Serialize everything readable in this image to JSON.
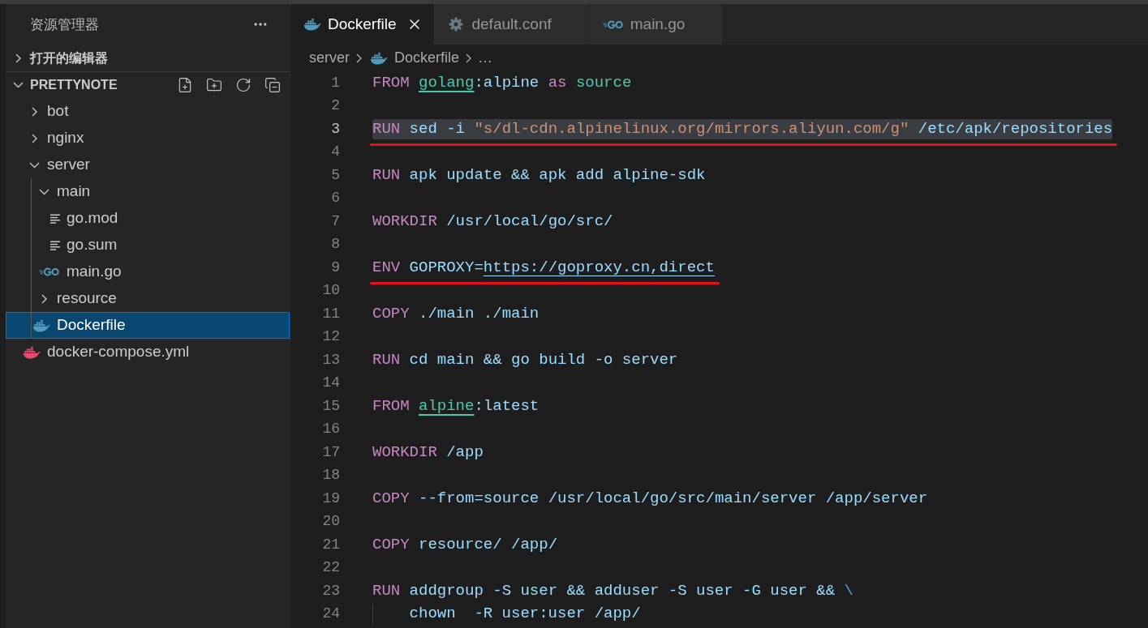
{
  "sidebar": {
    "title": "资源管理器",
    "sections": [
      {
        "label": "打开的编辑器",
        "expanded": false,
        "toolbar": false
      },
      {
        "label": "PRETTYNOTE",
        "expanded": true,
        "toolbar": true,
        "items": [
          {
            "label": "bot",
            "kind": "folder",
            "expanded": false,
            "selected": false
          },
          {
            "label": "nginx",
            "kind": "folder",
            "expanded": false,
            "selected": false
          },
          {
            "label": "server",
            "kind": "folder",
            "expanded": true,
            "selected": false,
            "children": [
              {
                "label": "main",
                "kind": "folder",
                "expanded": true,
                "selected": false,
                "children": [
                  {
                    "label": "go.mod",
                    "kind": "text-file",
                    "selected": false
                  },
                  {
                    "label": "go.sum",
                    "kind": "text-file",
                    "selected": false
                  },
                  {
                    "label": "main.go",
                    "kind": "go-file",
                    "selected": false
                  }
                ]
              },
              {
                "label": "resource",
                "kind": "folder",
                "expanded": false,
                "selected": false
              },
              {
                "label": "Dockerfile",
                "kind": "dockerfile",
                "selected": true
              }
            ]
          },
          {
            "label": "docker-compose.yml",
            "kind": "compose-file",
            "selected": false
          }
        ]
      }
    ]
  },
  "tabs": [
    {
      "label": "Dockerfile",
      "kind": "dockerfile",
      "selected": true
    },
    {
      "label": "default.conf",
      "kind": "config-file",
      "selected": false
    },
    {
      "label": "main.go",
      "kind": "go-file",
      "selected": false
    }
  ],
  "breadcrumbs": [
    {
      "label": "server",
      "kind": "folder"
    },
    {
      "label": "Dockerfile",
      "kind": "dockerfile"
    },
    {
      "label": "…",
      "kind": "more"
    }
  ],
  "editor": {
    "lines": [
      {
        "number": "1",
        "selected": false,
        "annotated": false,
        "tokens": [
          {
            "kind": "keyword",
            "text": "FROM "
          },
          {
            "kind": "image",
            "text": "golang"
          },
          {
            "kind": "text",
            "text": ":alpine "
          },
          {
            "kind": "keyword",
            "text": "as "
          },
          {
            "kind": "stage",
            "text": "source"
          }
        ]
      },
      {
        "number": "2",
        "selected": false,
        "annotated": false
      },
      {
        "number": "3",
        "selected": true,
        "annotated": true,
        "tokens": [
          {
            "kind": "keyword",
            "text": "RUN "
          },
          {
            "kind": "text",
            "text": "sed -i "
          },
          {
            "kind": "string",
            "text": "\"s/dl-cdn.alpinelinux.org/mirrors.aliyun.com/g\""
          },
          {
            "kind": "text",
            "text": " /etc/apk/repositories"
          }
        ]
      },
      {
        "number": "4",
        "selected": false,
        "annotated": false
      },
      {
        "number": "5",
        "selected": false,
        "annotated": false,
        "tokens": [
          {
            "kind": "keyword",
            "text": "RUN "
          },
          {
            "kind": "text",
            "text": "apk update && apk add alpine-sdk"
          }
        ]
      },
      {
        "number": "6",
        "selected": false,
        "annotated": false
      },
      {
        "number": "7",
        "selected": false,
        "annotated": false,
        "tokens": [
          {
            "kind": "keyword",
            "text": "WORKDIR "
          },
          {
            "kind": "text",
            "text": "/usr/local/go/src/"
          }
        ]
      },
      {
        "number": "8",
        "selected": false,
        "annotated": false
      },
      {
        "number": "9",
        "selected": false,
        "annotated": true,
        "tokens": [
          {
            "kind": "keyword",
            "text": "ENV "
          },
          {
            "kind": "text",
            "text": "GOPROXY="
          },
          {
            "kind": "url",
            "text": "https://goproxy.cn,direct"
          }
        ]
      },
      {
        "number": "10",
        "selected": false,
        "annotated": false
      },
      {
        "number": "11",
        "selected": false,
        "annotated": false,
        "tokens": [
          {
            "kind": "keyword",
            "text": "COPY "
          },
          {
            "kind": "text",
            "text": "./main ./main"
          }
        ]
      },
      {
        "number": "12",
        "selected": false,
        "annotated": false
      },
      {
        "number": "13",
        "selected": false,
        "annotated": false,
        "tokens": [
          {
            "kind": "keyword",
            "text": "RUN "
          },
          {
            "kind": "text",
            "text": "cd main && go build -o server"
          }
        ]
      },
      {
        "number": "14",
        "selected": false,
        "annotated": false
      },
      {
        "number": "15",
        "selected": false,
        "annotated": false,
        "tokens": [
          {
            "kind": "keyword",
            "text": "FROM "
          },
          {
            "kind": "image",
            "text": "alpine"
          },
          {
            "kind": "text",
            "text": ":latest"
          }
        ]
      },
      {
        "number": "16",
        "selected": false,
        "annotated": false
      },
      {
        "number": "17",
        "selected": false,
        "annotated": false,
        "tokens": [
          {
            "kind": "keyword",
            "text": "WORKDIR "
          },
          {
            "kind": "text",
            "text": "/app"
          }
        ]
      },
      {
        "number": "18",
        "selected": false,
        "annotated": false
      },
      {
        "number": "19",
        "selected": false,
        "annotated": false,
        "tokens": [
          {
            "kind": "keyword",
            "text": "COPY "
          },
          {
            "kind": "text",
            "text": "--from=source /usr/local/go/src/main/server /app/server"
          }
        ]
      },
      {
        "number": "20",
        "selected": false,
        "annotated": false
      },
      {
        "number": "21",
        "selected": false,
        "annotated": false,
        "tokens": [
          {
            "kind": "keyword",
            "text": "COPY "
          },
          {
            "kind": "text",
            "text": "resource/ /app/"
          }
        ]
      },
      {
        "number": "22",
        "selected": false,
        "annotated": false
      },
      {
        "number": "23",
        "selected": false,
        "annotated": false,
        "tokens": [
          {
            "kind": "keyword",
            "text": "RUN "
          },
          {
            "kind": "text",
            "text": "addgroup -S user && adduser -S user -G user && "
          },
          {
            "kind": "escape",
            "text": "\\"
          }
        ]
      },
      {
        "number": "24",
        "selected": false,
        "annotated": false,
        "tokens": [
          {
            "kind": "indent"
          },
          {
            "kind": "text",
            "text": "chown  -R user:user /app/"
          }
        ]
      }
    ]
  }
}
